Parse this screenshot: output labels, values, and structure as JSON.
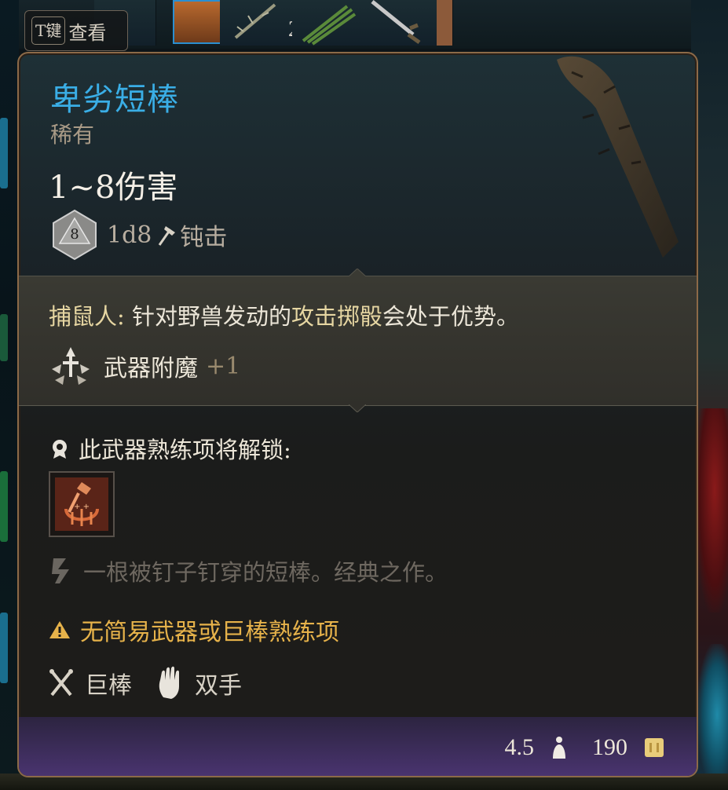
{
  "hotbar": {
    "t_key": "T键",
    "t_key_action": "查看",
    "slot_count": "2"
  },
  "item": {
    "name": "卑劣短棒",
    "rarity": "稀有",
    "damage": "1~8伤害",
    "dice_face": "8",
    "dice": "1d8",
    "damage_type": "钝击"
  },
  "passive": {
    "name": "捕鼠人:",
    "text_prefix": " 针对野兽发动的",
    "keyword": "攻击掷骰",
    "text_suffix": "会处于优势。"
  },
  "enchant": {
    "label": "武器附魔",
    "value": "+1"
  },
  "proficiency": {
    "unlock_label": "此武器熟练项将解锁:"
  },
  "flavor": "一根被钉子钉穿的短棒。经典之作。",
  "warning": "无简易武器或巨棒熟练项",
  "tags": {
    "weapon_type": "巨棒",
    "handedness": "双手"
  },
  "footer": {
    "weight": "4.5",
    "gold": "190"
  },
  "colors": {
    "title": "#3aaee6",
    "warning": "#e6b24a",
    "border": "#8c6a48"
  }
}
